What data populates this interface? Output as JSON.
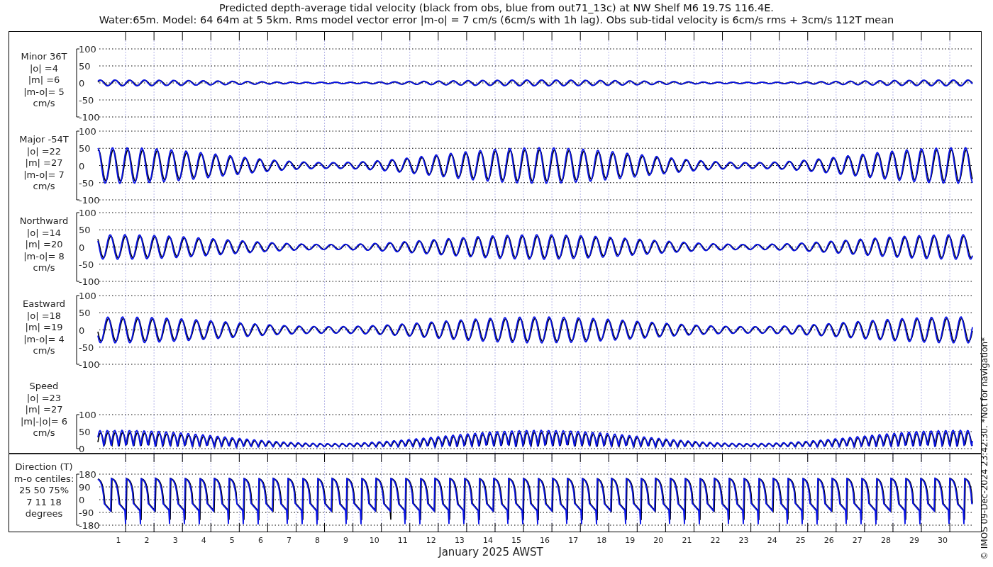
{
  "title_lines": [
    "Predicted depth-average tidal velocity (black from obs, blue from out71_13c) at NW Shelf M6 19.7S 116.4E.",
    "Water:65m. Model: 64 64m at 5 5km. Rms model vector error |m-o| = 7 cm/s (6cm/s with 1h lag). Obs sub-tidal velocity is 6cm/s rms + 3cm/s 112T mean"
  ],
  "panels": [
    {
      "kind": "velocity",
      "label_lines": [
        "Minor 36T",
        "|o| =4",
        "|m| =6",
        "|m-o|= 5",
        "cm/s"
      ],
      "yticks": [
        "100",
        "50",
        "0",
        "-50",
        "-100"
      ]
    },
    {
      "kind": "velocity",
      "label_lines": [
        "Major -54T",
        "|o| =22",
        "|m| =27",
        "|m-o|= 7",
        "cm/s"
      ],
      "yticks": [
        "100",
        "50",
        "0",
        "-50",
        "-100"
      ]
    },
    {
      "kind": "velocity",
      "label_lines": [
        "Northward",
        "|o| =14",
        "|m| =20",
        "|m-o|= 8",
        "cm/s"
      ],
      "yticks": [
        "100",
        "50",
        "0",
        "-50",
        "-100"
      ]
    },
    {
      "kind": "velocity",
      "label_lines": [
        "Eastward",
        "|o| =18",
        "|m| =19",
        "|m-o|= 4",
        "cm/s"
      ],
      "yticks": [
        "100",
        "50",
        "0",
        "-50",
        "-100"
      ]
    },
    {
      "kind": "speed",
      "label_lines": [
        "Speed",
        "|o| =23",
        "|m| =27",
        "|m|-|o|= 6",
        "cm/s"
      ],
      "yticks": [
        "100",
        "50",
        "0"
      ]
    },
    {
      "kind": "direction",
      "label_lines": [
        "Direction (T)",
        "m-o centiles:",
        "25  50  75%",
        "7  11  18",
        "degrees"
      ],
      "yticks": [
        "180",
        "90",
        "0",
        "-90",
        "-180"
      ]
    }
  ],
  "x_axis": {
    "day_labels": [
      "1",
      "2",
      "3",
      "4",
      "5",
      "6",
      "7",
      "8",
      "9",
      "10",
      "11",
      "12",
      "13",
      "14",
      "15",
      "16",
      "17",
      "18",
      "19",
      "20",
      "21",
      "22",
      "23",
      "24",
      "25",
      "26",
      "27",
      "28",
      "29",
      "30"
    ],
    "label": "January 2025 AWST"
  },
  "footer_note": "© IMOS 09-Dec-2024 23:42:30. *Not for navigation*"
}
